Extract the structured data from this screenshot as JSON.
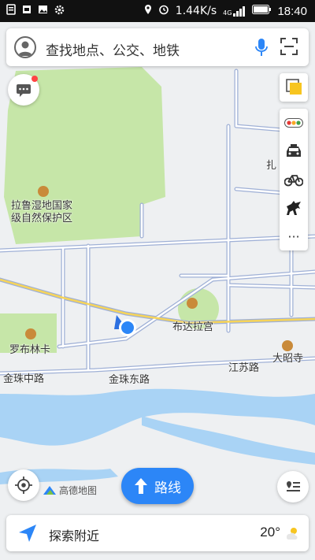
{
  "status_bar": {
    "network_speed": "1.44K/s",
    "signal_label": "4G",
    "time": "18:40"
  },
  "search": {
    "placeholder": "查找地点、公交、地铁"
  },
  "map": {
    "labels": {
      "wetland": "拉鲁湿地国家\n级自然保护区",
      "potala": "布达拉宫",
      "norbulingka": "罗布林卡",
      "jokhang": "大昭寺",
      "road_jinzhu_middle": "金珠中路",
      "road_jinzhu_east": "金珠东路",
      "road_jiangsu": "江苏路",
      "road_top_partial": "扎"
    },
    "colors": {
      "land": "#eef0f2",
      "park": "#c6e6a8",
      "water": "#a9d3f5",
      "road_fill": "#ffffff",
      "road_edge": "#9fb0d6",
      "major_road": "#f6d45a"
    }
  },
  "side_panel": {
    "items": [
      {
        "icon": "traffic-light-icon"
      },
      {
        "icon": "taxi-icon"
      },
      {
        "icon": "bicycle-icon"
      },
      {
        "icon": "horse-icon"
      },
      {
        "icon": "more-icon",
        "label": "···"
      }
    ]
  },
  "brand": {
    "logo_text": "高德地图"
  },
  "route_button": {
    "label": "路线"
  },
  "bottom_bar": {
    "explore_label": "探索附近",
    "temperature": "20°"
  }
}
